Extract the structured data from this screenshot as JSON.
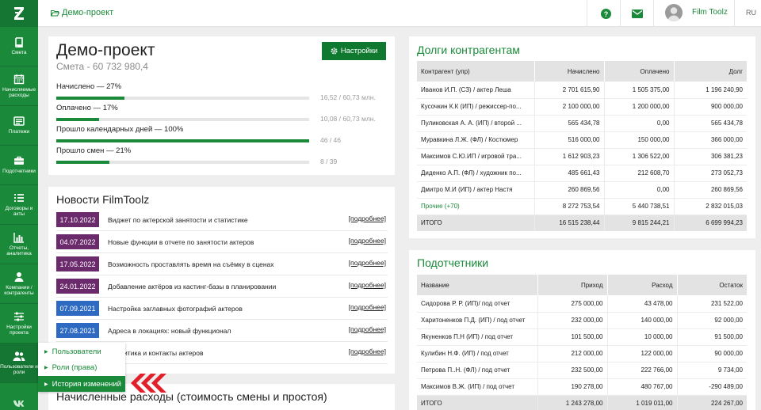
{
  "sidebar": {
    "items": [
      {
        "label": "Смета",
        "icon": "book-icon"
      },
      {
        "label": "Начисляемые\nрасходы",
        "icon": "calendar-icon"
      },
      {
        "label": "Платежи",
        "icon": "wallet-icon"
      },
      {
        "label": "Подотчетники",
        "icon": "briefcase-icon"
      },
      {
        "label": "Договоры и\nакты",
        "icon": "list-icon"
      },
      {
        "label": "Отчеты,\nаналитика",
        "icon": "bar-chart-icon"
      },
      {
        "label": "Компании /\nконтрагенты",
        "icon": "user-icon"
      },
      {
        "label": "Настройки\nпроекта",
        "icon": "sliders-icon"
      },
      {
        "label": "Пользователи и\nроли",
        "icon": "users-icon"
      }
    ]
  },
  "topbar": {
    "breadcrumb": "Демо-проект",
    "user_name": "Film Toolz",
    "lang": "RU"
  },
  "project": {
    "title": "Демо-проект",
    "subtitle": "Смета - 60 732 980,4",
    "settings_label": "Настройки",
    "progress": [
      {
        "label": "Начислено — 27%",
        "value": "16,52 / 60,73 млн.",
        "pct": 27
      },
      {
        "label": "Оплачено — 17%",
        "value": "10,08 / 60,73 млн.",
        "pct": 17
      },
      {
        "label": "Прошло календарных дней — 100%",
        "value": "46 / 46",
        "pct": 100
      },
      {
        "label": "Прошло смен — 21%",
        "value": "8 / 39",
        "pct": 21
      }
    ]
  },
  "news": {
    "title": "Новости FilmToolz",
    "more_label": "[подробнее]",
    "items": [
      {
        "date": "17.10.2022",
        "text": "Виджет по актерской занятости и статистике",
        "color": "#6b2a6b"
      },
      {
        "date": "04.07.2022",
        "text": "Новые функции в отчете по занятости актеров",
        "color": "#6b2a6b"
      },
      {
        "date": "17.05.2022",
        "text": "Возможность проставлять время на съёмку в сценах",
        "color": "#6b2a6b"
      },
      {
        "date": "24.01.2022",
        "text": "Добавление актёров из кастинг-базы в планировании",
        "color": "#6b2a6b"
      },
      {
        "date": "07.09.2021",
        "text": "Настройка заглавных фотографий актеров",
        "color": "#2f6ac2"
      },
      {
        "date": "27.08.2021",
        "text": "Адреса в локациях: новый функционал",
        "color": "#2f6ac2"
      },
      {
        "date": "",
        "text": "Аналитика и контакты актеров",
        "color": "#2f6ac2"
      }
    ]
  },
  "dropdown": {
    "items": [
      {
        "label": "Пользователи"
      },
      {
        "label": "Роли (права)"
      },
      {
        "label": "История изменений"
      }
    ]
  },
  "accrued": {
    "title": "Начисленные расходы (стоимость смены и простоя)"
  },
  "debts": {
    "title": "Долги контрагентам",
    "headers": [
      "Контрагент (упр)",
      "Начислено",
      "Оплачено",
      "Долг"
    ],
    "rows": [
      [
        "Иванов И.П. (СЗ) / актер Леша",
        "2 701 615,90",
        "1 505 375,00",
        "1 196 240,90"
      ],
      [
        "Кусочкин К.К (ИП) / режиссер-по...",
        "2 100 000,00",
        "1 200 000,00",
        "900 000,00"
      ],
      [
        "Пуликовская А. А. (ИП) / второй ...",
        "565 434,78",
        "0,00",
        "565 434,78"
      ],
      [
        "Муравкина Л.Ж. (ФЛ) / Костюмер",
        "516 000,00",
        "150 000,00",
        "366 000,00"
      ],
      [
        "Максимов С.Ю.ИП / игровой тра...",
        "1 612 903,23",
        "1 306 522,00",
        "306 381,23"
      ],
      [
        "Диденко А.П. (ФЛ) / художник по...",
        "485 661,43",
        "212 608,70",
        "273 052,73"
      ],
      [
        "Дмитро М.И (ИП) / актер Настя",
        "260 869,56",
        "0,00",
        "260 869,56"
      ],
      [
        "Прочие (+70)",
        "8 272 753,54",
        "5 440 738,51",
        "2 832 015,03"
      ]
    ],
    "total": [
      "ИТОГО",
      "16 515 238,44",
      "9 815 244,21",
      "6 699 994,23"
    ]
  },
  "accountable": {
    "title": "Подотчетники",
    "headers": [
      "Название",
      "Приход",
      "Расход",
      "Остаток"
    ],
    "rows": [
      [
        "Сидорова Р. Р. (ИП)/ под отчет",
        "275 000,00",
        "43 478,00",
        "231 522,00"
      ],
      [
        "Харитоненков П.Д. (ИП) / под отчет",
        "232 000,00",
        "140 000,00",
        "92 000,00"
      ],
      [
        "Якуненков П.Н (ИП) / под отчет",
        "101 500,00",
        "10 000,00",
        "91 500,00"
      ],
      [
        "Кулибин Н.Ф. (ИП) / под отчет",
        "212 000,00",
        "122 000,00",
        "90 000,00"
      ],
      [
        "Петрова П..Н. (ФЛ) / под отчет",
        "232 500,00",
        "222 766,00",
        "9 734,00"
      ],
      [
        "Максимов В.Ж. (ИП) / под отчет",
        "190 278,00",
        "480 767,00",
        "-290 489,00"
      ]
    ],
    "total": [
      "ИТОГО",
      "1 243 278,00",
      "1 019 011,00",
      "224 267,00"
    ]
  },
  "colors": {
    "accent": "#1a8a3a",
    "news_purple": "#6b2a6b",
    "news_blue": "#2f6ac2",
    "arrow_red": "#e0202a"
  }
}
